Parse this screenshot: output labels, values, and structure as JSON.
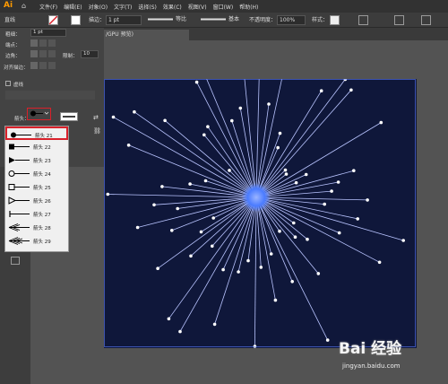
{
  "app": {
    "logo": "Ai"
  },
  "menubar": {
    "items": [
      "文件(F)",
      "编辑(E)",
      "对象(O)",
      "文字(T)",
      "选择(S)",
      "效果(C)",
      "视图(V)",
      "窗口(W)",
      "帮助(H)"
    ]
  },
  "controlbar": {
    "path_label": "直线",
    "stroke_label": "描边：",
    "stroke_weight": "1 pt",
    "profile_label": "等比",
    "brush_label": "基本",
    "opacity_label": "不透明度：",
    "opacity_value": "100%",
    "style_label": "样式："
  },
  "stroke_panel": {
    "weight_label": "粗细：",
    "weight_value": "1 pt",
    "cap_label": "端点：",
    "corner_label": "边角：",
    "limit_label": "限制：",
    "limit_value": "10",
    "align_label": "对齐描边：",
    "dashed_label": "虚线",
    "arrowhead_label": "箭头："
  },
  "document_tab": {
    "label": "/GPU 预览)"
  },
  "arrow_dropdown": {
    "items": [
      {
        "label": "箭头 21",
        "icon": "arrow-dot-icon",
        "selected": true
      },
      {
        "label": "箭头 22",
        "icon": "arrow-square-icon"
      },
      {
        "label": "箭头 23",
        "icon": "arrow-triangle-icon"
      },
      {
        "label": "箭头 24",
        "icon": "arrow-circle-outline-icon"
      },
      {
        "label": "箭头 25",
        "icon": "arrow-square-outline-icon"
      },
      {
        "label": "箭头 26",
        "icon": "arrow-triangle-outline-icon"
      },
      {
        "label": "箭头 27",
        "icon": "arrow-bar-icon"
      },
      {
        "label": "箭头 28",
        "icon": "arrow-feather-icon"
      },
      {
        "label": "箭头 29",
        "icon": "arrow-feather-icon"
      }
    ]
  },
  "watermark": {
    "logo_text": "Bai 经验",
    "url": "jingyan.baidu.com"
  },
  "colors": {
    "artboard": "#0f173a",
    "rays": "#b9c4ff",
    "center_glow": "#4a7bff",
    "highlight": "#d9202a"
  }
}
